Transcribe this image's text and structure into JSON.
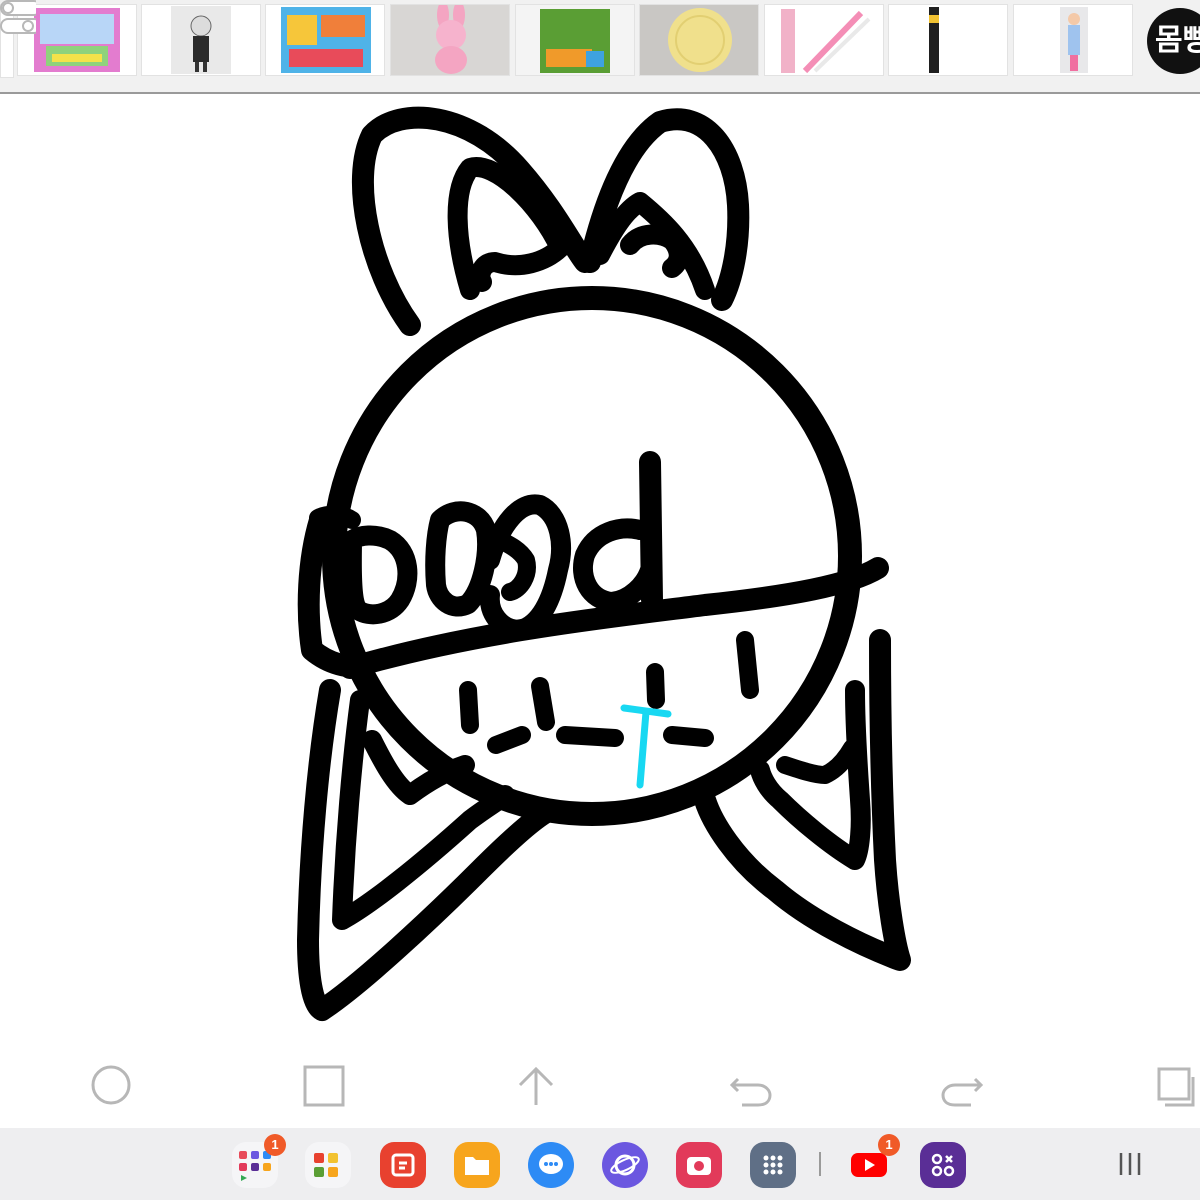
{
  "product_strip": {
    "items": [
      {
        "name": "product-thumb-playset",
        "color": "#d86fc5"
      },
      {
        "name": "product-thumb-doll",
        "color": "#3a3a3a"
      },
      {
        "name": "product-thumb-toy-box",
        "color": "#f2c230"
      },
      {
        "name": "product-thumb-plush-bunny",
        "color": "#f4a5c2"
      },
      {
        "name": "product-thumb-green-box",
        "color": "#5a9e34"
      },
      {
        "name": "product-thumb-yellow-plate",
        "color": "#f0e08c"
      },
      {
        "name": "product-thumb-utensils",
        "color": "#f48eb6"
      },
      {
        "name": "product-thumb-pen",
        "color": "#222222"
      },
      {
        "name": "product-thumb-fashion-doll",
        "color": "#9fc3ee"
      }
    ],
    "logo_text": "몸빵"
  },
  "tools": [
    {
      "name": "circle-tool-icon",
      "label": "circle"
    },
    {
      "name": "square-tool-icon",
      "label": "square"
    },
    {
      "name": "arrow-up-tool-icon",
      "label": "arrow"
    },
    {
      "name": "undo-icon",
      "label": "undo"
    },
    {
      "name": "redo-icon",
      "label": "redo"
    },
    {
      "name": "layers-icon",
      "label": "layers"
    }
  ],
  "taskbar": {
    "apps": [
      {
        "name": "app-folder-1",
        "badge": "1"
      },
      {
        "name": "app-folder-2",
        "badge": ""
      },
      {
        "name": "notes-app-icon",
        "badge": "",
        "color": "#e8412f"
      },
      {
        "name": "files-app-icon",
        "badge": "",
        "color": "#f7a51d"
      },
      {
        "name": "messages-app-icon",
        "badge": "",
        "color": "#2d8bf5"
      },
      {
        "name": "internet-app-icon",
        "badge": "",
        "color": "#6b57e0"
      },
      {
        "name": "camera-app-icon",
        "badge": "",
        "color": "#e23a5a"
      },
      {
        "name": "apps-drawer-icon",
        "badge": "",
        "color": "#5f6f86"
      },
      {
        "name": "youtube-app-icon",
        "badge": "1",
        "color": "#ffffff"
      },
      {
        "name": "game-launcher-icon",
        "badge": "",
        "color": "#5a2e96"
      }
    ]
  },
  "colors": {
    "ink": "#000000",
    "accent_stroke": "#18d8f2",
    "taskbar_bg": "#eeeef0"
  }
}
